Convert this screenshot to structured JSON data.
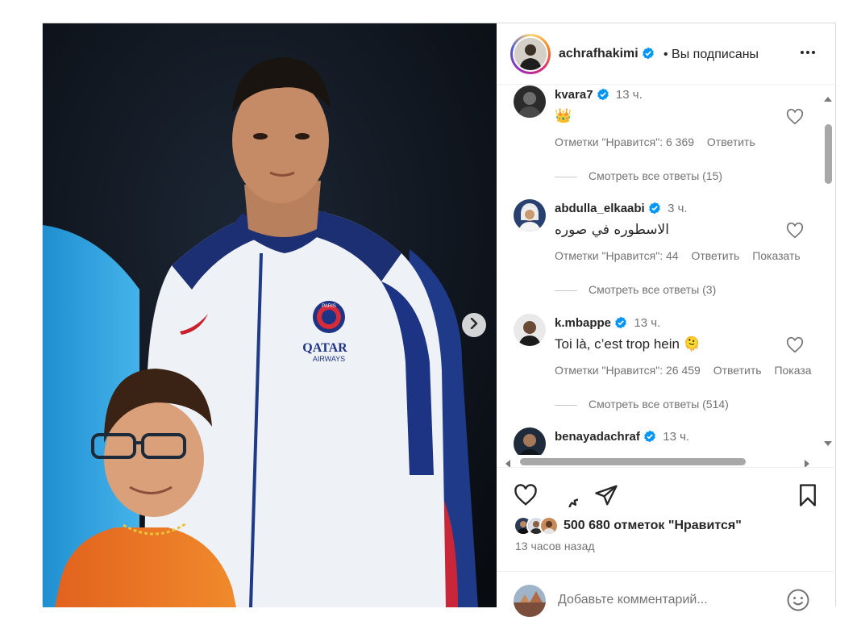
{
  "post": {
    "author": {
      "username": "achrafhakimi",
      "verified_icon": "verified-badge-icon",
      "follow_status": "• Вы подписаны",
      "more_icon": "more-dots-icon"
    },
    "media": {
      "next_icon": "chevron-right-icon",
      "jacket_text_1": "PARIS",
      "jacket_text_2": "QATAR",
      "jacket_text_3": "AIRWAYS"
    },
    "comments": [
      {
        "username": "kvara7",
        "time": "13 ч.",
        "text": "👑",
        "likes": "Отметки \"Нравится\": 6 369",
        "reply": "Ответить",
        "translate": "",
        "view_replies": "Смотреть все ответы (15)"
      },
      {
        "username": "abdulla_elkaabi",
        "time": "3 ч.",
        "text": "الاسطوره في صوره",
        "likes": "Отметки \"Нравится\": 44",
        "reply": "Ответить",
        "translate": "Показать",
        "view_replies": "Смотреть все ответы (3)"
      },
      {
        "username": "k.mbappe",
        "time": "13 ч.",
        "text": "Toi là, c’est trop hein 🫠",
        "likes": "Отметки \"Нравится\": 26 459",
        "reply": "Ответить",
        "translate": "Показа",
        "view_replies": "Смотреть все ответы (514)"
      },
      {
        "username": "benayadachraf",
        "time": "13 ч.",
        "text": "",
        "likes": "",
        "reply": "",
        "translate": "",
        "view_replies": ""
      }
    ],
    "actions": {
      "like_icon": "heart-icon",
      "comment_icon": "comment-bubble-icon",
      "share_icon": "paper-plane-icon",
      "save_icon": "bookmark-icon"
    },
    "likes_summary": "500 680 отметок \"Нравится\"",
    "posted_ago": "13 часов назад",
    "add_comment": {
      "placeholder": "Добавьте комментарий...",
      "emoji_icon": "emoji-smile-icon"
    },
    "colors": {
      "accent_blue": "#0095f6",
      "verified_blue": "#0095f6",
      "text_primary": "#262626",
      "text_secondary": "#737373",
      "border": "#dbdbdb"
    }
  }
}
